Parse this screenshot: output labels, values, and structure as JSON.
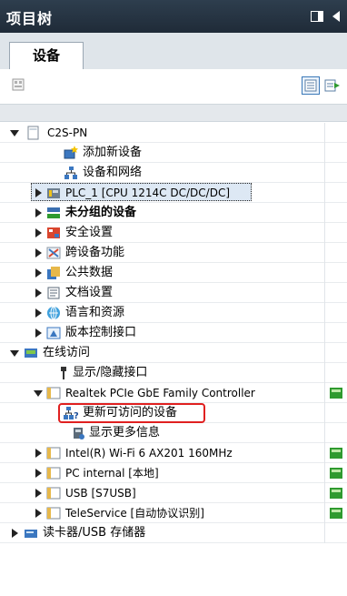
{
  "panel": {
    "title": "项目树",
    "tab_label": "设备"
  },
  "icons": {
    "title_grid": "panel-layout-icon",
    "title_collapse": "collapse-left-icon",
    "toolbar_left": "overview-icon",
    "toolbar_view": "detail-view-icon",
    "toolbar_right": "add-to-project-icon"
  },
  "colors": {
    "titlebar": "#26313d",
    "tab_strip": "#dfe5ea",
    "selected_row": "#dde8f4",
    "highlight": "#e02020",
    "folder": "#e7b84a",
    "status_green": "#2f9a2f"
  },
  "tree": {
    "rows": [
      {
        "label": "C2S-PN",
        "icon": "project-icon",
        "level": 0,
        "expanded": true
      },
      {
        "label": "添加新设备",
        "icon": "add-device-icon",
        "level": 1
      },
      {
        "label": "设备和网络",
        "icon": "network-icon",
        "level": 1
      },
      {
        "label": "PLC_1 [CPU 1214C DC/DC/DC]",
        "icon": "plc-icon",
        "level": 1,
        "expandable": true,
        "selected": true
      },
      {
        "label": "未分组的设备",
        "icon": "ungrouped-devices-icon",
        "level": 1,
        "expandable": true,
        "bold": true
      },
      {
        "label": "安全设置",
        "icon": "security-icon",
        "level": 1,
        "expandable": true
      },
      {
        "label": "跨设备功能",
        "icon": "cross-device-icon",
        "level": 1,
        "expandable": true
      },
      {
        "label": "公共数据",
        "icon": "common-data-icon",
        "level": 1,
        "expandable": true
      },
      {
        "label": "文档设置",
        "icon": "document-settings-icon",
        "level": 1,
        "expandable": true
      },
      {
        "label": "语言和资源",
        "icon": "language-icon",
        "level": 1,
        "expandable": true
      },
      {
        "label": "版本控制接口",
        "icon": "version-control-icon",
        "level": 1,
        "expandable": true
      },
      {
        "label": "在线访问",
        "icon": "online-access-icon",
        "level": 0,
        "expanded": true
      },
      {
        "label": "显示/隐藏接口",
        "icon": "interface-icon",
        "level": 1
      },
      {
        "label": "Realtek PCIe GbE Family Controller",
        "icon": "folder-icon",
        "level": 1,
        "expanded": true,
        "status": true
      },
      {
        "label": "更新可访问的设备",
        "icon": "update-accessible-icon",
        "level": 2,
        "highlighted": true
      },
      {
        "label": "显示更多信息",
        "icon": "more-info-icon",
        "level": 2
      },
      {
        "label": "Intel(R) Wi-Fi 6 AX201 160MHz",
        "icon": "folder-icon",
        "level": 1,
        "expandable": true,
        "status": true
      },
      {
        "label": "PC internal [本地]",
        "icon": "folder-icon",
        "level": 1,
        "expandable": true,
        "status": true
      },
      {
        "label": "USB [S7USB]",
        "icon": "folder-icon",
        "level": 1,
        "expandable": true,
        "status": true
      },
      {
        "label": "TeleService [自动协议识别]",
        "icon": "folder-icon",
        "level": 1,
        "expandable": true,
        "status": true
      },
      {
        "label": "读卡器/USB 存储器",
        "icon": "card-reader-icon",
        "level": 0,
        "expandable": true
      }
    ]
  }
}
